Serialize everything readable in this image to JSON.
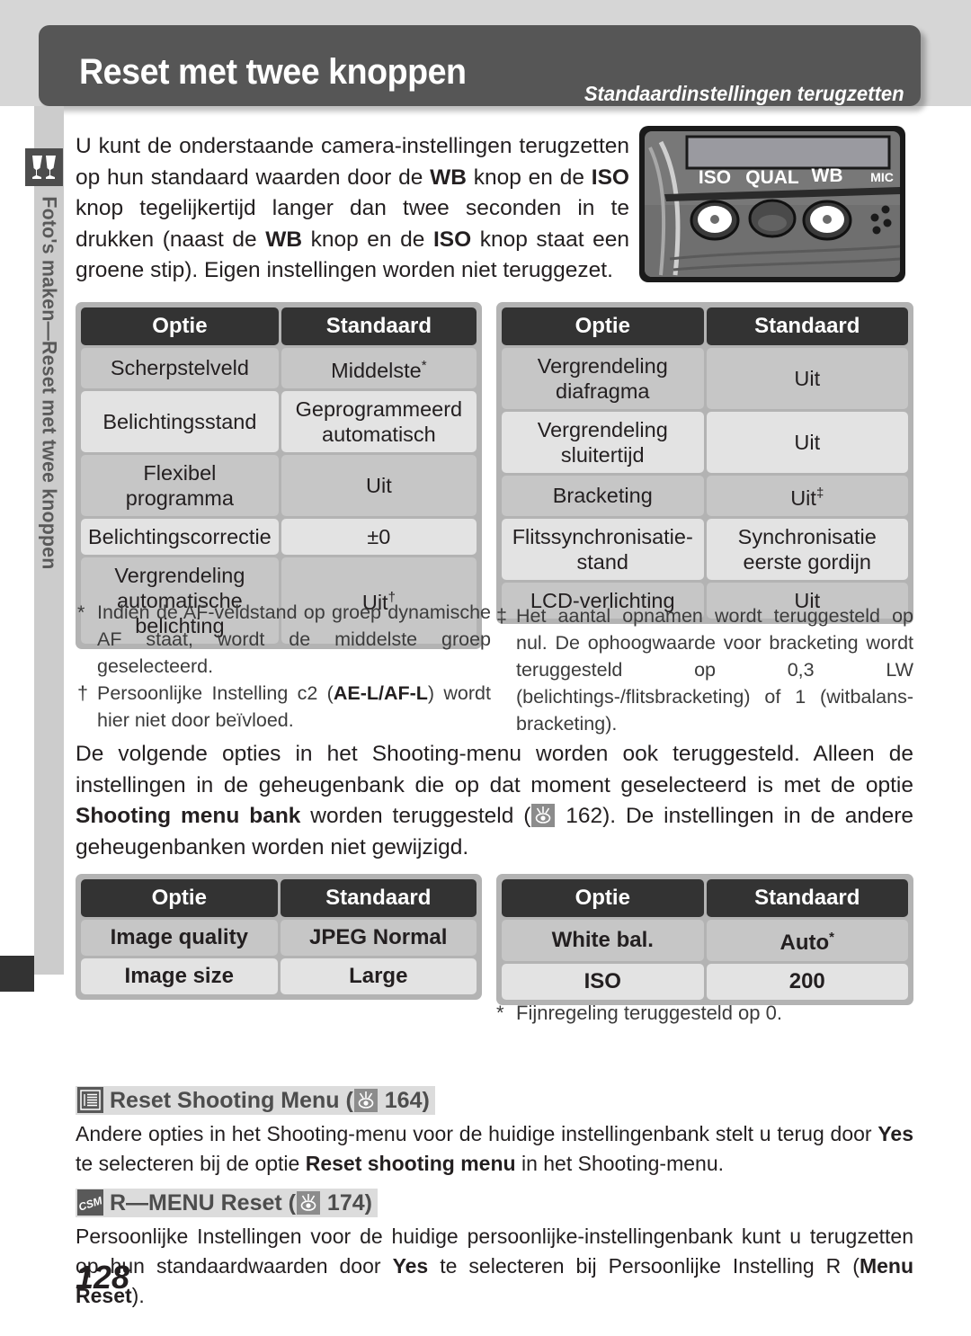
{
  "header": {
    "title": "Reset met twee knoppen",
    "subtitle": "Standaardinstellingen terugzetten"
  },
  "sidebar": {
    "icon": "shooting-mode-icon",
    "label": "Foto's maken—Reset met twee knoppen"
  },
  "intro": {
    "text_parts": [
      {
        "t": "U kunt de onderstaande camera-instellingen terugzetten op hun standaard waarden door de "
      },
      {
        "t": "WB",
        "b": true
      },
      {
        "t": " knop en de "
      },
      {
        "t": "ISO",
        "b": true
      },
      {
        "t": " knop tegelijkertijd langer dan twee seconden in te drukken (naast de "
      },
      {
        "t": "WB",
        "b": true
      },
      {
        "t": " knop en de "
      },
      {
        "t": "ISO",
        "b": true
      },
      {
        "t": " knop staat een groene stip). Eigen instellingen worden niet teruggezet."
      }
    ]
  },
  "camera": {
    "labels": [
      "ISO",
      "QUAL",
      "WB",
      "MIC"
    ]
  },
  "table_settings_left": {
    "headers": [
      "Optie",
      "Standaard"
    ],
    "rows": [
      {
        "option": "Scherpstelveld",
        "standard": "Middelste",
        "standard_sup": "*"
      },
      {
        "option": "Belichtingsstand",
        "standard": "Geprogrammeerd automatisch",
        "standard_sup": ""
      },
      {
        "option": "Flexibel programma",
        "standard": "Uit",
        "standard_sup": ""
      },
      {
        "option": "Belichtingscorrectie",
        "standard": "±0",
        "standard_sup": ""
      },
      {
        "option": "Vergrendeling automatische belichting",
        "standard": "Uit",
        "standard_sup": "†"
      }
    ]
  },
  "table_settings_right": {
    "headers": [
      "Optie",
      "Standaard"
    ],
    "rows": [
      {
        "option": "Vergrendeling diafragma",
        "standard": "Uit",
        "standard_sup": ""
      },
      {
        "option": "Vergrendeling sluitertijd",
        "standard": "Uit",
        "standard_sup": ""
      },
      {
        "option": "Bracketing",
        "standard": "Uit",
        "standard_sup": "‡"
      },
      {
        "option": "Flitssynchronisatie-stand",
        "standard": "Synchronisatie eerste gordijn",
        "standard_sup": ""
      },
      {
        "option": "LCD-verlichting",
        "standard": "Uit",
        "standard_sup": ""
      }
    ]
  },
  "footnote_left": [
    {
      "mark": "*",
      "parts": [
        {
          "t": "Indien de AF-veldstand op groep dynamische AF staat, wordt de middelste groep geselecteerd."
        }
      ]
    },
    {
      "mark": "†",
      "parts": [
        {
          "t": "Persoonlijke Instelling c2 ("
        },
        {
          "t": "AE-L/AF-L",
          "b": true
        },
        {
          "t": ") wordt hier niet door beïvloed."
        }
      ]
    }
  ],
  "footnote_right": [
    {
      "mark": "‡",
      "parts": [
        {
          "t": "Het aantal opnamen wordt teruggesteld op nul. De ophoogwaarde voor bracketing wordt teruggesteld op 0,3 LW (belichtings-/flitsbracketing) of 1 (witbalans-bracketing)."
        }
      ]
    }
  ],
  "mid_paragraph": {
    "parts": [
      {
        "t": "De volgende opties in het Shooting-menu worden ook teruggesteld. Alleen de instellingen in de geheugenbank die op dat moment geselecteerd is met de optie "
      },
      {
        "t": "Shooting menu bank",
        "b": true
      },
      {
        "t": " worden teruggesteld ("
      },
      {
        "icon": "page-ref-icon"
      },
      {
        "t": " 162). De instellingen in de andere geheugenbanken worden niet gewijzigd."
      }
    ],
    "page_ref": "162"
  },
  "table_shooting_left": {
    "headers": [
      "Optie",
      "Standaard"
    ],
    "rows": [
      {
        "option": "Image quality",
        "standard": "JPEG Normal",
        "standard_sup": ""
      },
      {
        "option": "Image size",
        "standard": "Large",
        "standard_sup": ""
      }
    ]
  },
  "table_shooting_right": {
    "headers": [
      "Optie",
      "Standaard"
    ],
    "rows": [
      {
        "option": "White bal.",
        "standard": "Auto",
        "standard_sup": "*"
      },
      {
        "option": "ISO",
        "standard": "200",
        "standard_sup": ""
      }
    ]
  },
  "footnote_wb": {
    "mark": "*",
    "text": "Fijnregeling teruggesteld op 0."
  },
  "notes": [
    {
      "icon": "menu-list-icon",
      "heading_before": "Reset Shooting Menu (",
      "page_ref": "164",
      "heading_after": ")",
      "body_parts": [
        {
          "t": "Andere opties in het Shooting-menu voor de huidige instellingenbank stelt u terug door "
        },
        {
          "t": "Yes",
          "b": true
        },
        {
          "t": " te selecteren bij de optie "
        },
        {
          "t": "Reset shooting menu",
          "b": true
        },
        {
          "t": " in het Shooting-menu."
        }
      ]
    },
    {
      "icon": "csm-badge-icon",
      "heading_before": "R—MENU Reset (",
      "page_ref": "174",
      "heading_after": ")",
      "body_parts": [
        {
          "t": "Persoonlijke Instellingen voor de huidige persoonlijke-instellingenbank kunt u terugzetten op hun standaardwaarden door "
        },
        {
          "t": "Yes",
          "b": true
        },
        {
          "t": " te selecteren bij Persoonlijke Instelling R ("
        },
        {
          "t": "Menu Reset",
          "b": true
        },
        {
          "t": ")."
        }
      ]
    }
  ],
  "page_number": "128",
  "colors": {
    "header_bg": "#565656",
    "band_bg": "#d6d6d6",
    "table_header_bg": "#333333",
    "row_odd": "#c6c6c6",
    "row_even": "#e3e3e3",
    "sidebar_bg": "#cccccc"
  }
}
